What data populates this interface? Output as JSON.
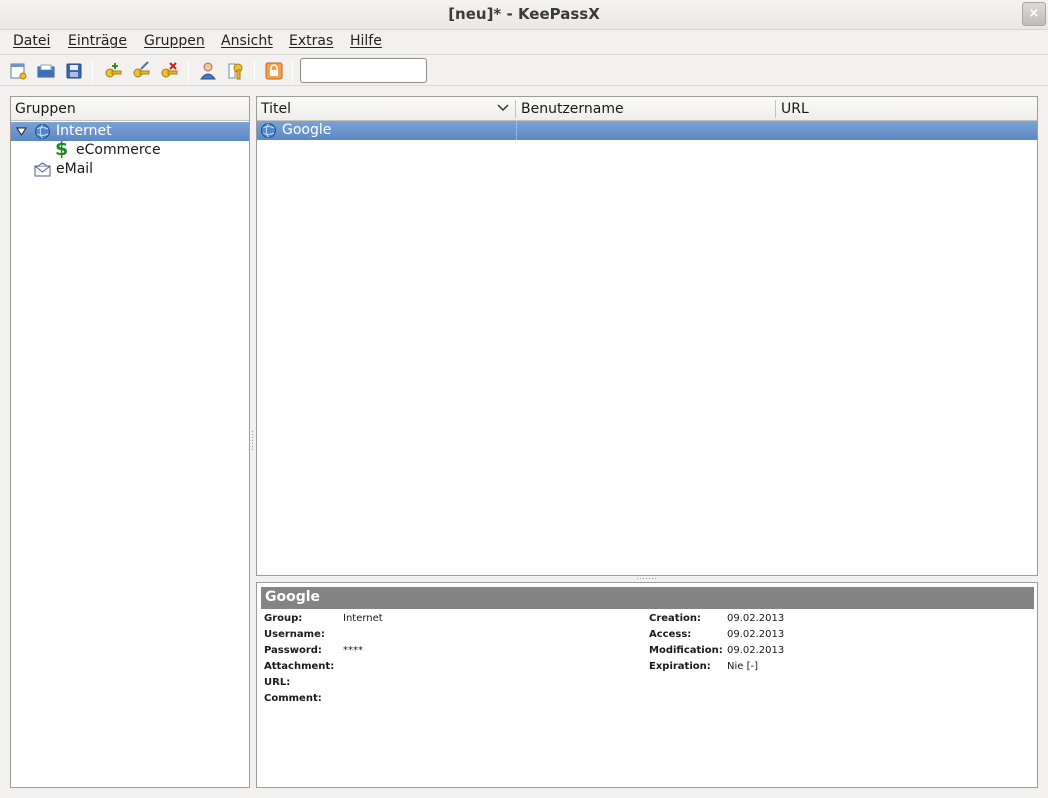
{
  "window": {
    "title": "[neu]* - KeePassX",
    "close": "×"
  },
  "menu": {
    "items": [
      "Datei",
      "Einträge",
      "Gruppen",
      "Ansicht",
      "Extras",
      "Hilfe"
    ]
  },
  "toolbar": {
    "buttons": [
      "new-database-icon",
      "open-database-icon",
      "save-database-icon",
      "add-entry-icon",
      "edit-entry-icon",
      "delete-entry-icon",
      "copy-username-icon",
      "copy-password-icon",
      "lock-workspace-icon"
    ],
    "search_value": ""
  },
  "groups": {
    "header": "Gruppen",
    "items": [
      {
        "label": "Internet",
        "icon": "globe-icon",
        "expanded": true,
        "selected": true
      },
      {
        "label": "eCommerce",
        "icon": "dollar-icon",
        "selected": false
      },
      {
        "label": "eMail",
        "icon": "envelope-icon",
        "selected": false
      }
    ]
  },
  "entries": {
    "columns": [
      "Titel",
      "Benutzername",
      "URL"
    ],
    "rows": [
      {
        "title": "Google",
        "username": "",
        "url": "",
        "icon": "globe-icon"
      }
    ]
  },
  "details": {
    "title": "Google",
    "left": [
      {
        "key": "Group:",
        "value": "Internet"
      },
      {
        "key": "Username:",
        "value": ""
      },
      {
        "key": "Password:",
        "value": "****"
      },
      {
        "key": "Attachment:",
        "value": ""
      },
      {
        "key": "URL:",
        "value": ""
      },
      {
        "key": "Comment:",
        "value": ""
      }
    ],
    "right": [
      {
        "key": "Creation:",
        "value": "09.02.2013"
      },
      {
        "key": "Access:",
        "value": "09.02.2013"
      },
      {
        "key": "Modification:",
        "value": "09.02.2013"
      },
      {
        "key": "Expiration:",
        "value": "Nie [-]"
      }
    ]
  },
  "colors": {
    "selection": "#6a93cc",
    "detail_header": "#848484"
  }
}
